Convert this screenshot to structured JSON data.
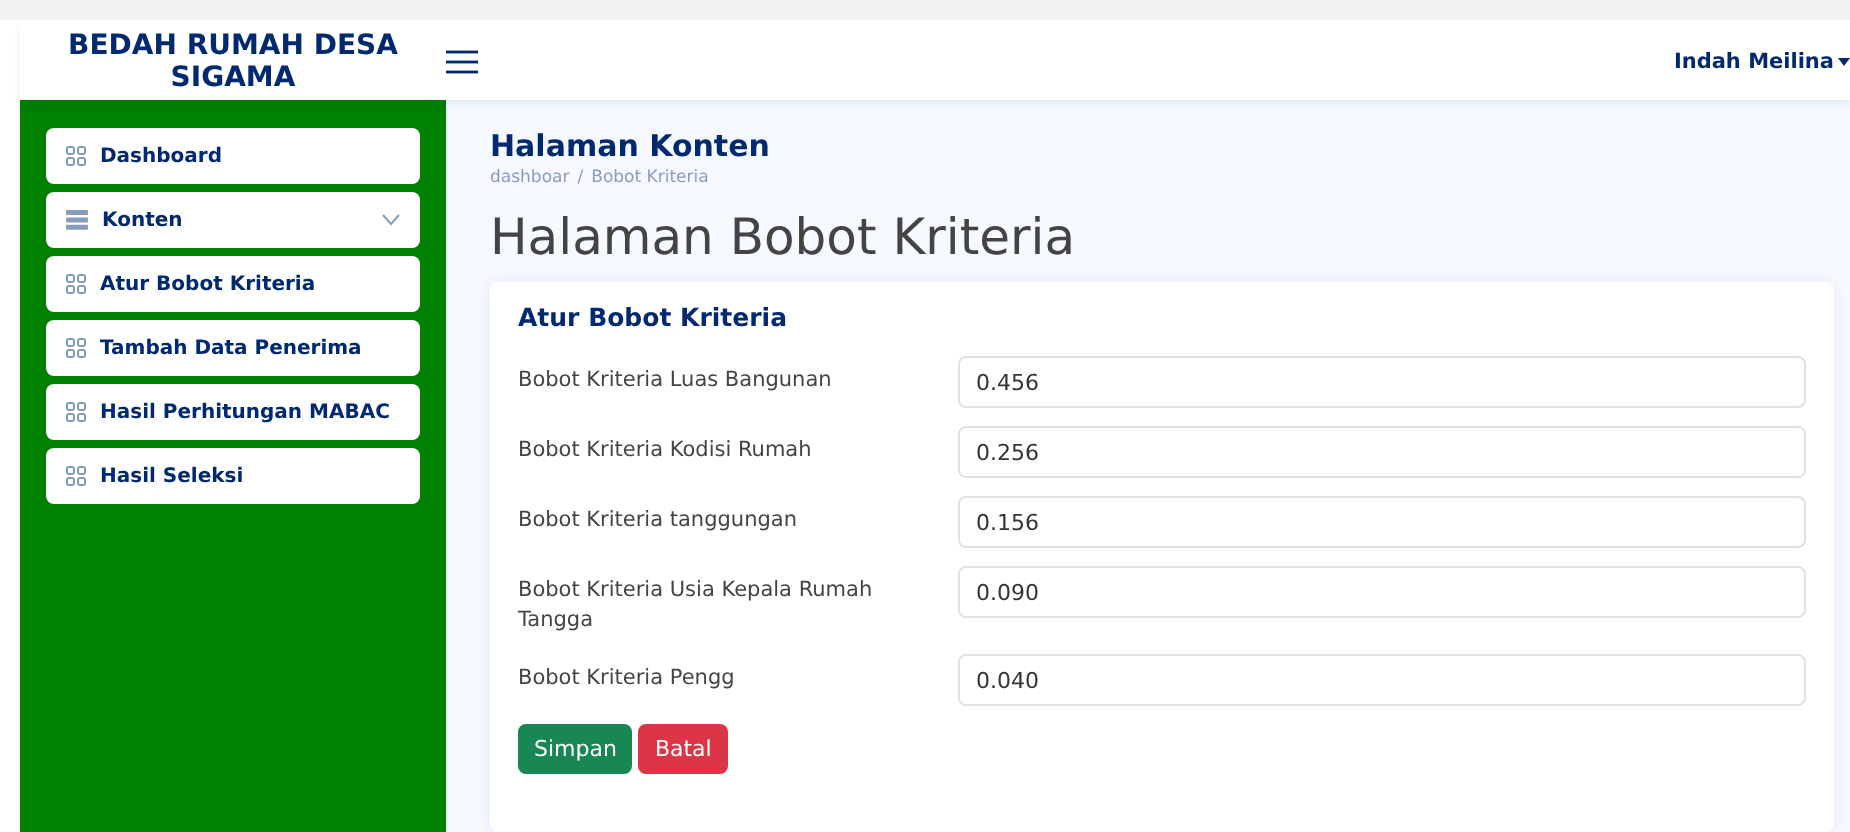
{
  "header": {
    "brand": "BEDAH RUMAH DESA SIGAMA",
    "user": "Indah Meilina"
  },
  "sidebar": {
    "items": [
      {
        "label": "Dashboard",
        "kind": "link"
      },
      {
        "label": "Konten",
        "kind": "dropdown",
        "expanded": false
      },
      {
        "label": "Atur Bobot Kriteria",
        "kind": "link"
      },
      {
        "label": "Tambah Data Penerima",
        "kind": "link"
      },
      {
        "label": "Hasil Perhitungan MABAC",
        "kind": "link"
      },
      {
        "label": "Hasil Seleksi",
        "kind": "link"
      }
    ]
  },
  "page": {
    "section_title": "Halaman Konten",
    "breadcrumb": [
      "dashboar",
      "Bobot Kriteria"
    ],
    "breadcrumb_separator": "/",
    "title": "Halaman Bobot Kriteria"
  },
  "form": {
    "title": "Atur Bobot Kriteria",
    "fields": [
      {
        "label": "Bobot Kriteria Luas Bangunan",
        "value": "0.456"
      },
      {
        "label": "Bobot Kriteria Kodisi Rumah",
        "value": "0.256"
      },
      {
        "label": "Bobot Kriteria tanggungan",
        "value": "0.156"
      },
      {
        "label": "Bobot Kriteria Usia Kepala Rumah Tangga",
        "value": "0.090"
      },
      {
        "label": "Bobot Kriteria Pengg",
        "value": "0.040"
      }
    ],
    "buttons": [
      {
        "label": "Simpan",
        "kind": "primary"
      },
      {
        "label": "Batal",
        "kind": "danger"
      }
    ]
  }
}
